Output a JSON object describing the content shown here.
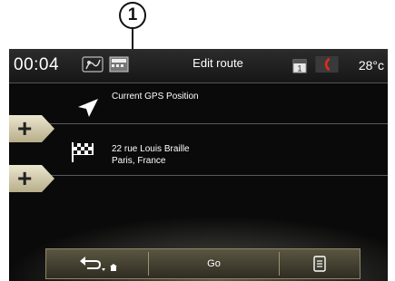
{
  "callout": {
    "number": "1"
  },
  "status_bar": {
    "time": "00:04",
    "title": "Edit route",
    "temperature": "28°c",
    "icons": [
      "map-route-icon",
      "media-icon",
      "calendar-icon",
      "phone-icon"
    ],
    "calendar_day": "1"
  },
  "waypoints": [
    {
      "icon": "navigation-arrow-icon",
      "lines": [
        "Current GPS Position"
      ]
    },
    {
      "icon": "checkered-flag-icon",
      "lines": [
        "22 rue Louis Braille",
        "Paris, France"
      ]
    }
  ],
  "bottom_bar": {
    "back_icon": "back-home-icon",
    "go_label": "Go",
    "menu_icon": "list-menu-icon"
  },
  "colors": {
    "tab": "#d9d2b6",
    "phone_icon": "#d0241c",
    "bar": "#5b5642"
  }
}
